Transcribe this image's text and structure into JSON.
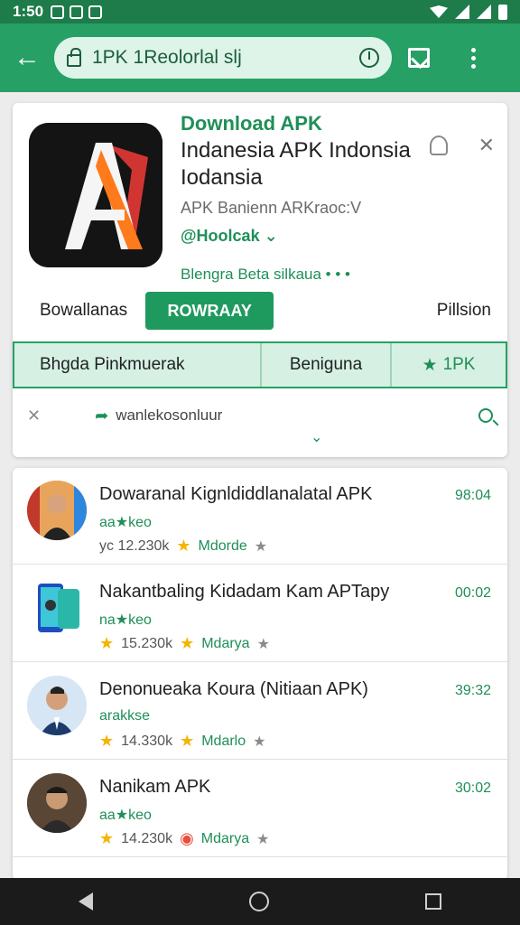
{
  "status_bar": {
    "time": "1:50"
  },
  "toolbar": {
    "url": "1PK 1Reolorlal slj"
  },
  "app": {
    "kicker": "Download APK",
    "title": "Indanesia APK Indonsia Iodansia",
    "subtitle": "APK Banienn ARKraoc:V",
    "developer": "@Hoolcak",
    "beta": "Blengra Beta silkaua",
    "left_label": "Bowallanas",
    "install_label": "ROWRAAY",
    "right_label": "Pillsion",
    "info": {
      "c1": "Bhgda Pinkmuerak",
      "c2": "Beniguna",
      "c3": "1PK"
    },
    "dev_link": "wanlekosonluur"
  },
  "list": [
    {
      "name": "Dowaranal Kignldiddlanalatal APK",
      "tag": "aa★keo",
      "count": "yc 12.230k",
      "mlabel": "Mdorde",
      "time": "98:04",
      "avatar_bg": "#f0b48a"
    },
    {
      "name": "Nakantbaling Kidadam Kam APTapy",
      "tag": "na★keo",
      "count": "15.230k",
      "mlabel": "Mdarya",
      "time": "00:02",
      "avatar_bg": "#3aa6c8"
    },
    {
      "name": "Denonueaka Koura (Nitiaan APK)",
      "tag": "arakkse",
      "count": "14.330k",
      "mlabel": "Mdarlo",
      "time": "39:32",
      "avatar_bg": "#d7e6f5"
    },
    {
      "name": "Nanikam APK",
      "tag": "aa★keo",
      "count": "14.230k",
      "mlabel": "Mdarya",
      "time": "30:02",
      "avatar_bg": "#5a4635"
    }
  ]
}
